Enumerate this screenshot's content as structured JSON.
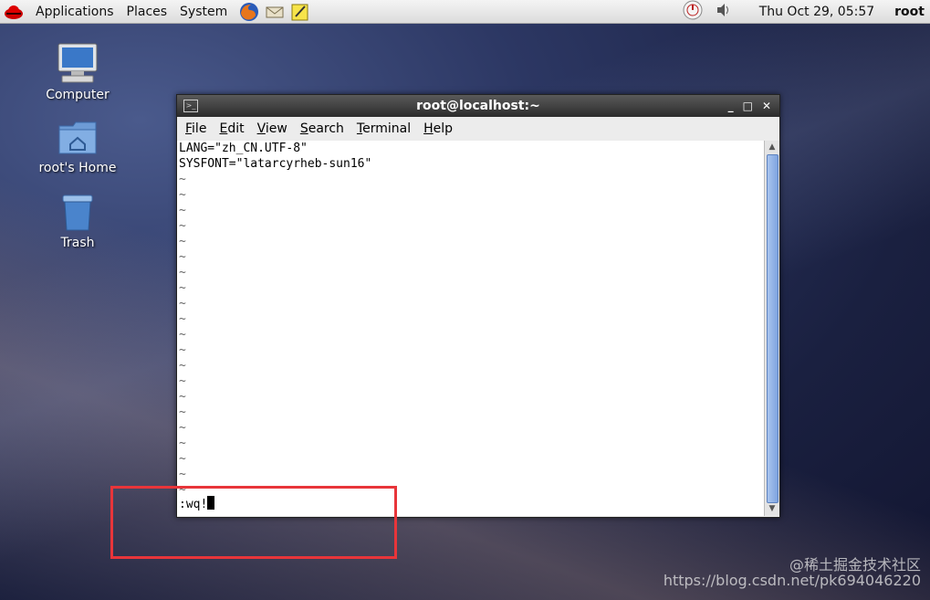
{
  "panel": {
    "menus": [
      "Applications",
      "Places",
      "System"
    ],
    "clock": "Thu Oct 29, 05:57",
    "user": "root",
    "launchers": [
      "firefox-icon",
      "mail-icon",
      "notes-icon"
    ]
  },
  "desktop": {
    "icons": [
      {
        "label": "Computer",
        "icon": "computer-icon"
      },
      {
        "label": "root's Home",
        "icon": "home-folder-icon"
      },
      {
        "label": "Trash",
        "icon": "trash-icon"
      }
    ]
  },
  "terminal": {
    "title": "root@localhost:~",
    "menu": [
      {
        "first": "F",
        "rest": "ile"
      },
      {
        "first": "E",
        "rest": "dit"
      },
      {
        "first": "V",
        "rest": "iew"
      },
      {
        "first": "S",
        "rest": "earch"
      },
      {
        "first": "T",
        "rest": "erminal"
      },
      {
        "first": "H",
        "rest": "elp"
      }
    ],
    "lines": [
      "LANG=\"zh_CN.UTF-8\"",
      "SYSFONT=\"latarcyrheb-sun16\""
    ],
    "tilde_char": "~",
    "tilde_count": 21,
    "command": ":wq!"
  },
  "watermark": "https://blog.csdn.net/pk694046220",
  "watermark_overlay": "@稀土掘金技术社区",
  "colors": {
    "highlight_box": "#e8353a",
    "scroll_thumb": "#8fb1e6"
  }
}
